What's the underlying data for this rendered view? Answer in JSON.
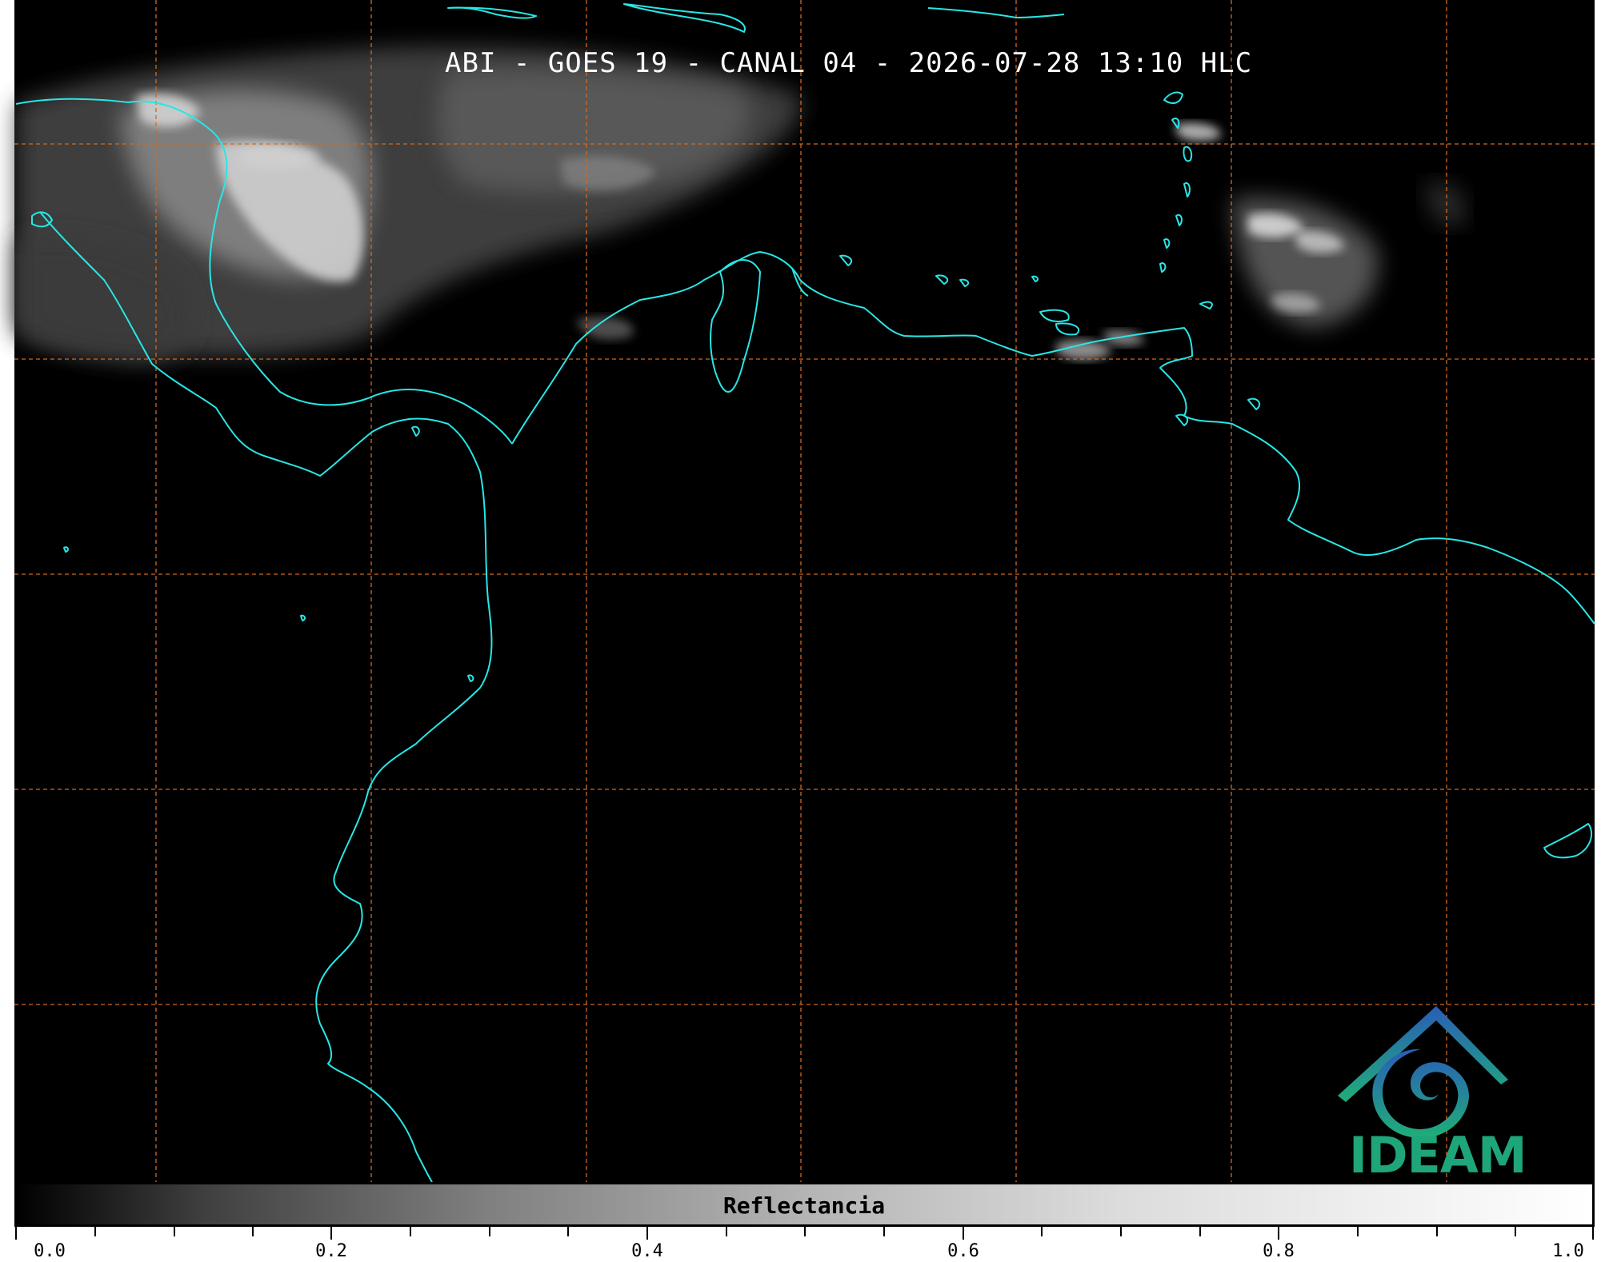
{
  "title": "ABI - GOES 19 - CANAL 04 - 2026-07-28 13:10 HLC",
  "logo": {
    "name": "IDEAM"
  },
  "colorbar": {
    "label": "Reflectancia",
    "ticks": [
      "0.0",
      "0.2",
      "0.4",
      "0.6",
      "0.8",
      "1.0"
    ],
    "min": 0.0,
    "max": 1.0
  },
  "colors": {
    "background": "#000000",
    "coastline": "#29e6e6",
    "graticule": "#d2691e",
    "logo_blue": "#1f6fb5",
    "logo_green": "#1fa57a"
  },
  "map_layers": {
    "graticule": "dashed",
    "coastlines": "on",
    "clouds": "reflectance-grayscale"
  }
}
